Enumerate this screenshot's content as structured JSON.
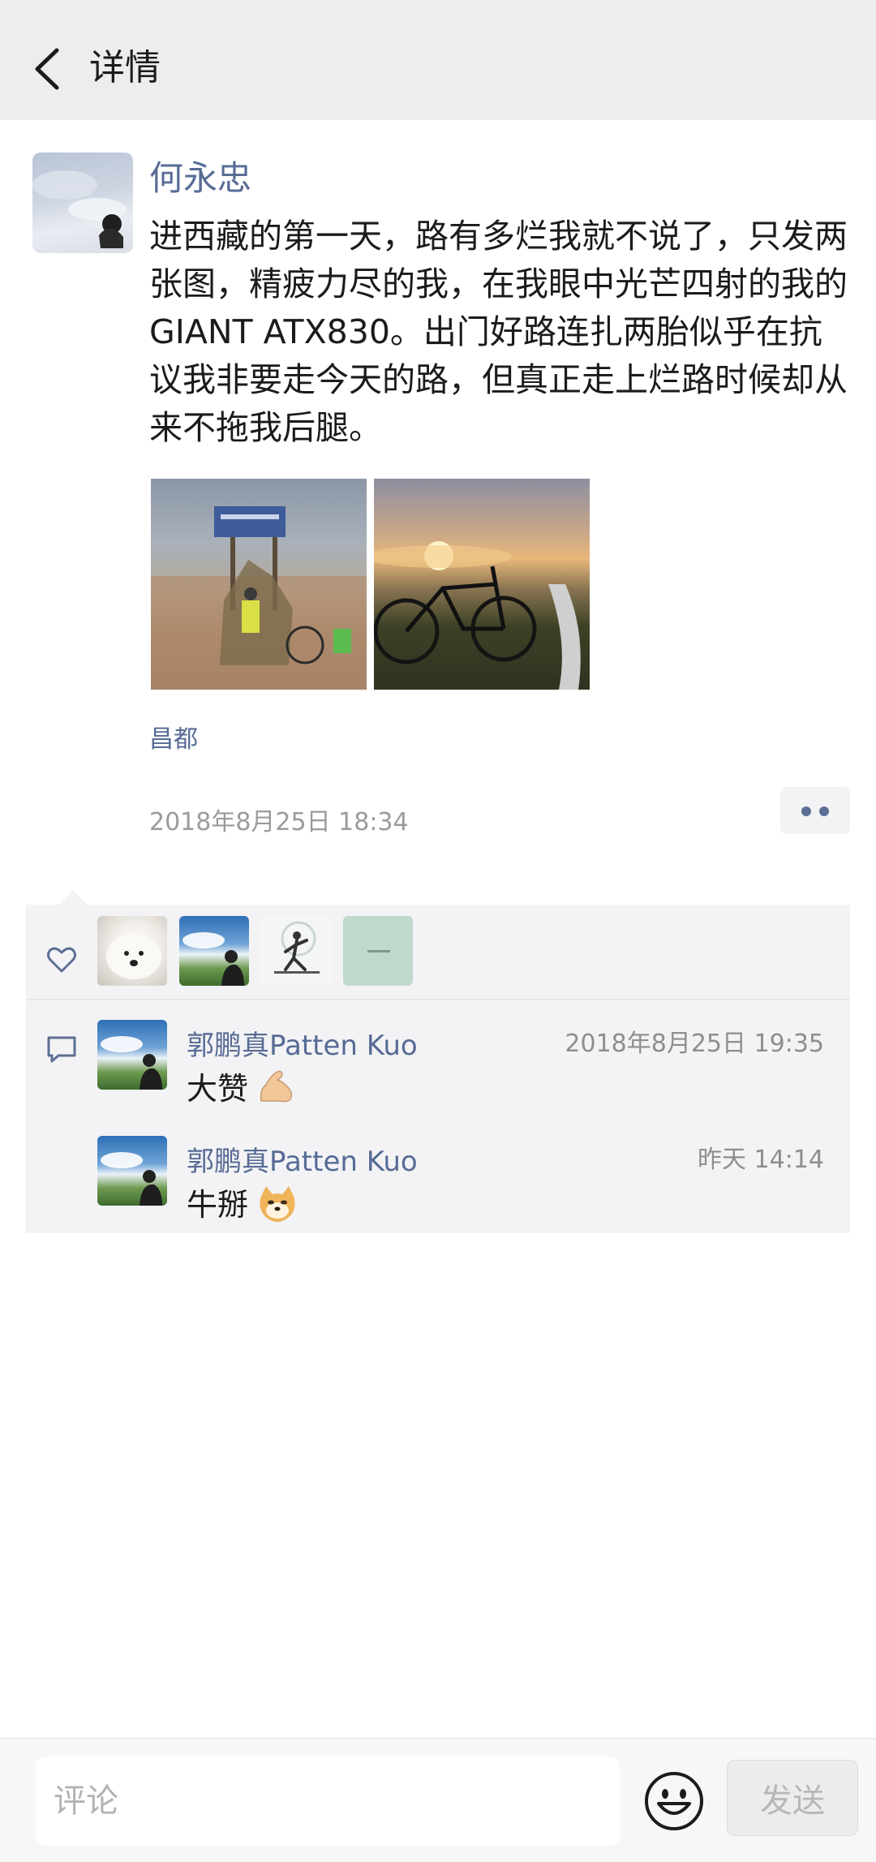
{
  "header": {
    "title": "详情"
  },
  "post": {
    "author": "何永忠",
    "text": "进西藏的第一天，路有多烂我就不说了，只发两张图，精疲力尽的我，在我眼中光芒四射的我的GIANT ATX830。出门好路连扎两胎似乎在抗议我非要走今天的路，但真正走上烂路时候却从来不拖我后腿。",
    "location": "昌都",
    "time": "2018年8月25日 18:34"
  },
  "comments": [
    {
      "name": "郭鹏真Patten Kuo",
      "time": "2018年8月25日 19:35",
      "text": "大赞",
      "emoji": "flexed-biceps-icon"
    },
    {
      "name": "郭鹏真Patten Kuo",
      "time": "昨天 14:14",
      "text": "牛掰",
      "emoji": "doge-face-icon"
    }
  ],
  "input": {
    "placeholder": "评论"
  },
  "send_label": "发送",
  "colors": {
    "link": "#576b95",
    "header_bg": "#ededed",
    "panel_bg": "#f3f3f5"
  }
}
